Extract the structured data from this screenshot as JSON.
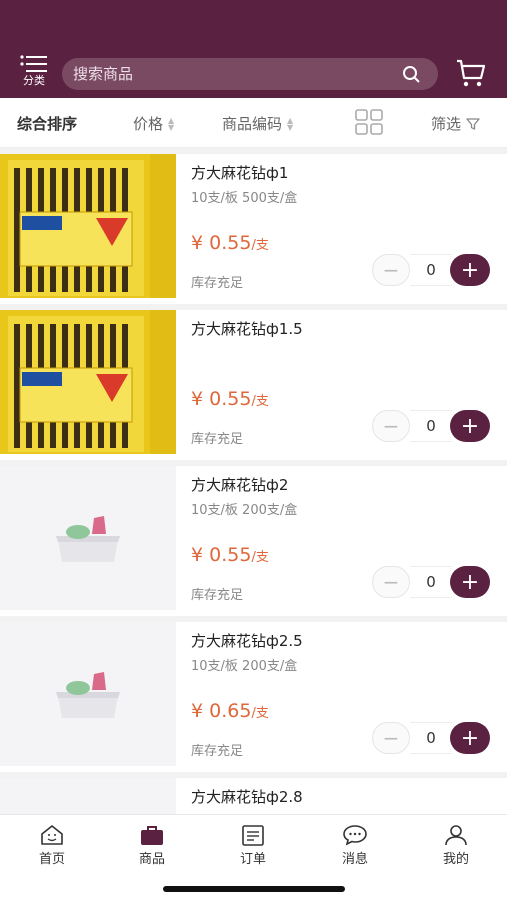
{
  "header": {
    "category_label": "分类",
    "search_placeholder": "搜索商品"
  },
  "sortbar": {
    "items": [
      {
        "label": "综合排序",
        "active": true
      },
      {
        "label": "价格",
        "active": false
      },
      {
        "label": "商品编码",
        "active": false
      }
    ],
    "filter_label": "筛选"
  },
  "products": [
    {
      "name": "方大麻花钻ф1",
      "spec": "10支/板 500支/盒",
      "price": "¥ 0.55",
      "unit": "/支",
      "stock": "库存充足",
      "qty": "0",
      "image": "photo"
    },
    {
      "name": "方大麻花钻ф1.5",
      "spec": "",
      "price": "¥ 0.55",
      "unit": "/支",
      "stock": "库存充足",
      "qty": "0",
      "image": "photo"
    },
    {
      "name": "方大麻花钻ф2",
      "spec": "10支/板 200支/盒",
      "price": "¥ 0.55",
      "unit": "/支",
      "stock": "库存充足",
      "qty": "0",
      "image": "placeholder"
    },
    {
      "name": "方大麻花钻ф2.5",
      "spec": "10支/板 200支/盒",
      "price": "¥ 0.65",
      "unit": "/支",
      "stock": "库存充足",
      "qty": "0",
      "image": "placeholder"
    },
    {
      "name": "方大麻花钻ф2.8"
    }
  ],
  "tabs": [
    {
      "label": "首页",
      "icon": "home-icon",
      "active": false
    },
    {
      "label": "商品",
      "icon": "bag-icon",
      "active": true
    },
    {
      "label": "订单",
      "icon": "order-icon",
      "active": false
    },
    {
      "label": "消息",
      "icon": "message-icon",
      "active": false
    },
    {
      "label": "我的",
      "icon": "profile-icon",
      "active": false
    }
  ],
  "colors": {
    "brand": "#5a2141",
    "price": "#e0673a"
  }
}
